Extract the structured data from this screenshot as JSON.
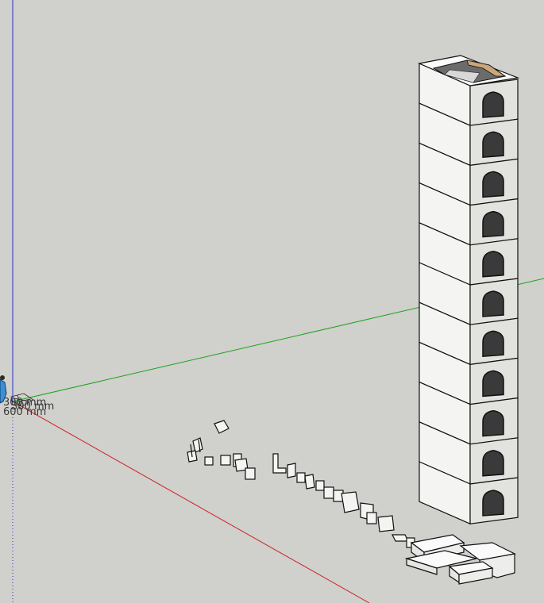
{
  "viewport": {
    "background": "#d0d0cd",
    "axes": {
      "x_color": "#cc1f1f",
      "y_color": "#1aa31a",
      "z_color": "#2b2bd0"
    }
  },
  "dimensions": [
    {
      "label": "300 mm"
    },
    {
      "label": "300 mm"
    },
    {
      "label": "600 mm"
    }
  ],
  "tower": {
    "floors": 11,
    "window_color": "#3a3a3a",
    "face_light": "#f4f4f2",
    "face_side": "#e2e2df",
    "rim_color": "#c9a77a"
  },
  "icons": {
    "person": "person-figure-icon"
  }
}
